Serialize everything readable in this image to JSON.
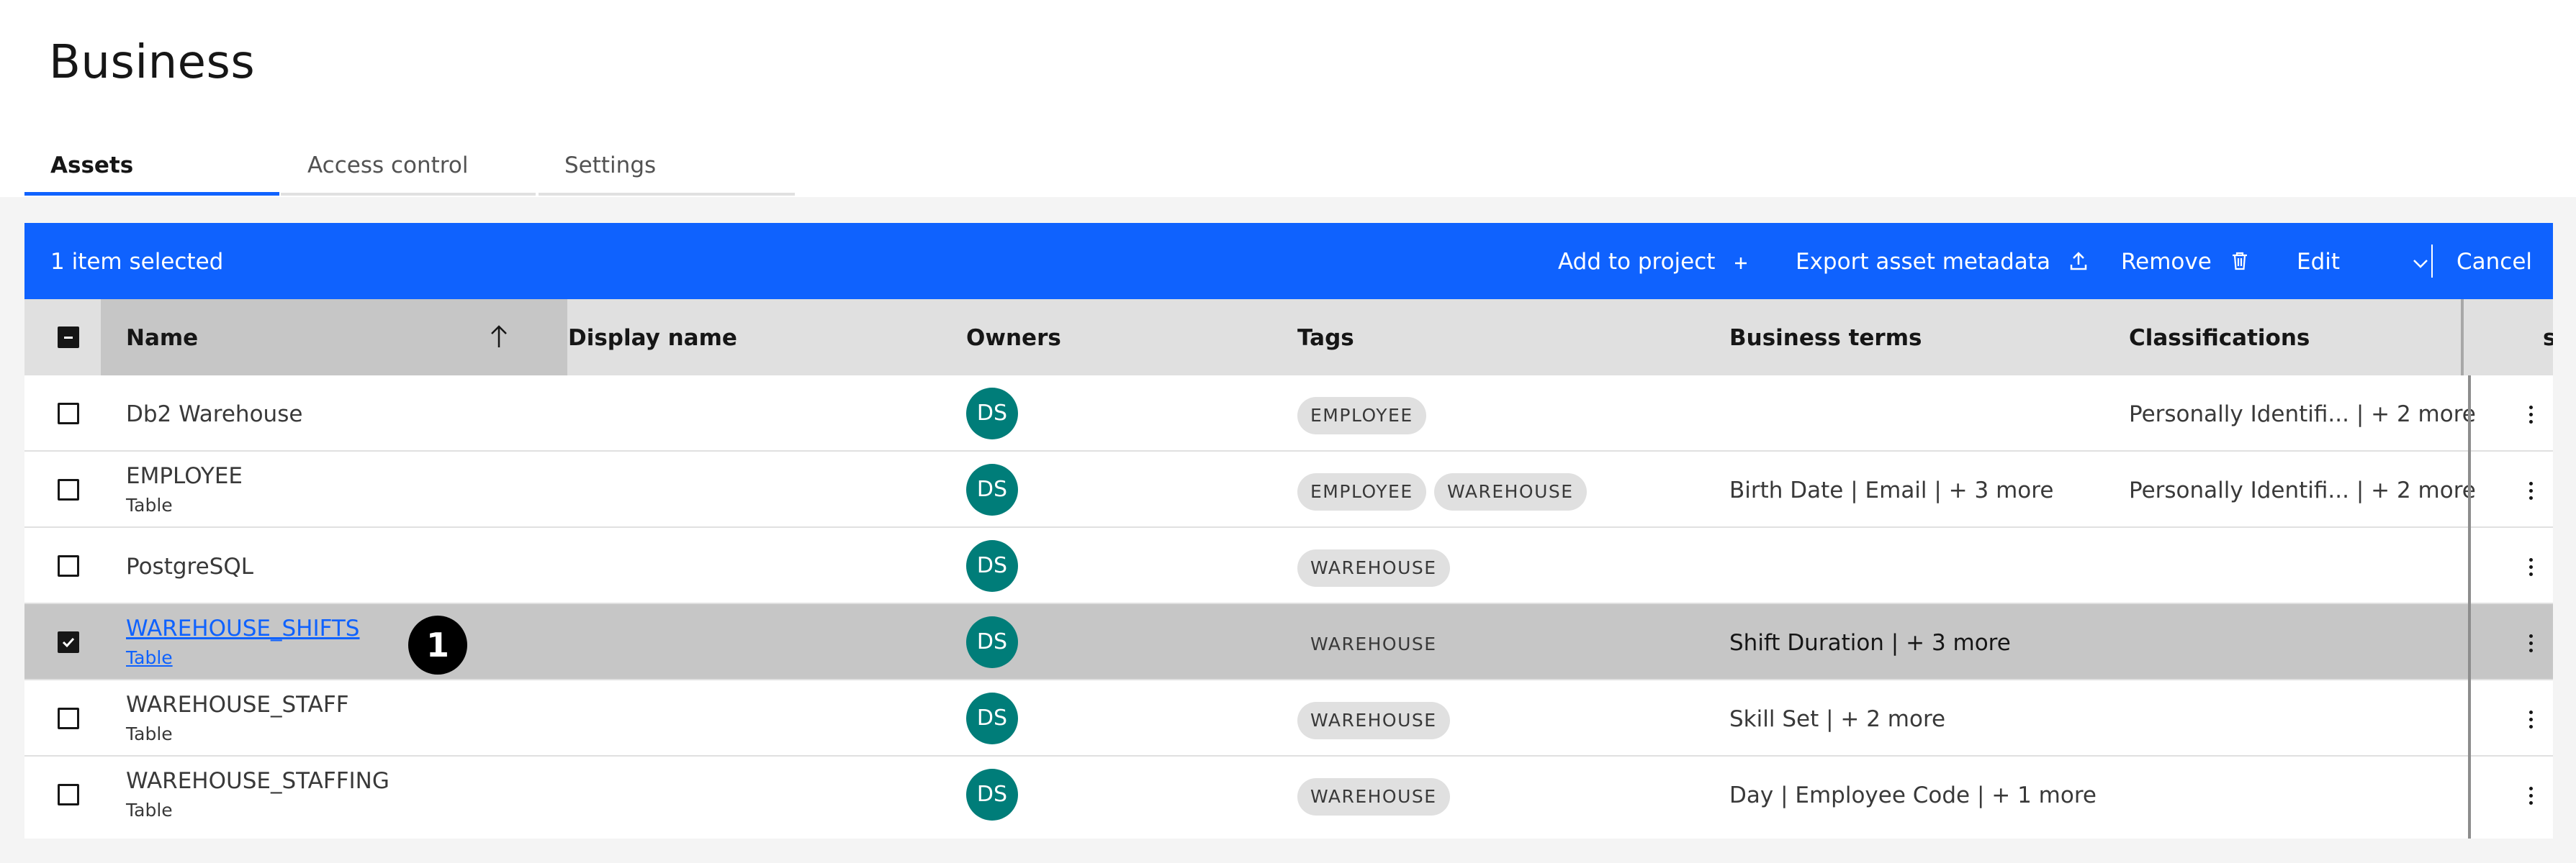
{
  "page": {
    "title": "Business"
  },
  "tabs": [
    {
      "label": "Assets",
      "active": true
    },
    {
      "label": "Access control",
      "active": false
    },
    {
      "label": "Settings",
      "active": false
    }
  ],
  "batch_bar": {
    "selection_text": "1 item selected",
    "actions": {
      "add_to_project": "Add to project",
      "export": "Export asset metadata",
      "remove": "Remove",
      "edit": "Edit",
      "cancel": "Cancel"
    }
  },
  "table": {
    "columns": [
      "Name",
      "Display name",
      "Owners",
      "Tags",
      "Business terms",
      "Classifications",
      "s"
    ],
    "sort": {
      "column": "Name",
      "direction": "ascending"
    },
    "rows": [
      {
        "name": "Db2 Warehouse",
        "type": "",
        "owner": "DS",
        "tags": [
          "EMPLOYEE"
        ],
        "business_terms": "",
        "classifications": "Personally Identifi... | + 2 more",
        "selected": false
      },
      {
        "name": "EMPLOYEE",
        "type": "Table",
        "owner": "DS",
        "tags": [
          "EMPLOYEE",
          "WAREHOUSE"
        ],
        "business_terms": "Birth Date | Email | + 3 more",
        "classifications": "Personally Identifi... | + 2 more",
        "selected": false
      },
      {
        "name": "PostgreSQL",
        "type": "",
        "owner": "DS",
        "tags": [
          "WAREHOUSE"
        ],
        "business_terms": "",
        "classifications": "",
        "selected": false
      },
      {
        "name": "WAREHOUSE_SHIFTS",
        "type": "Table",
        "owner": "DS",
        "tags": [
          "WAREHOUSE"
        ],
        "business_terms": "Shift Duration | + 3 more",
        "classifications": "",
        "selected": true
      },
      {
        "name": "WAREHOUSE_STAFF",
        "type": "Table",
        "owner": "DS",
        "tags": [
          "WAREHOUSE"
        ],
        "business_terms": "Skill Set | + 2 more",
        "classifications": "",
        "selected": false
      },
      {
        "name": "WAREHOUSE_STAFFING",
        "type": "Table",
        "owner": "DS",
        "tags": [
          "WAREHOUSE"
        ],
        "business_terms": "Day | Employee Code | + 1 more",
        "classifications": "",
        "selected": false
      }
    ]
  },
  "annotation": {
    "step": "1"
  },
  "colors": {
    "accent": "#0f62fe",
    "avatar": "#007d79",
    "selected_row": "#c6c6c6",
    "header": "#e0e0e0"
  },
  "icons": [
    "add-icon",
    "upload-icon",
    "trash-icon",
    "chevron-down-icon",
    "sort-ascending-icon",
    "overflow-menu-icon"
  ]
}
